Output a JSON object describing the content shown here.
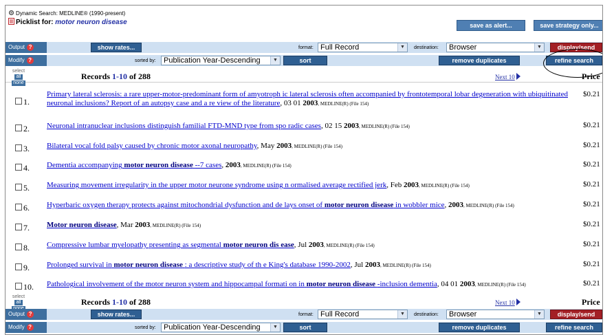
{
  "header": {
    "search_label": "Dynamic Search: MEDLINE® (1990-present)",
    "picklist_prefix": "Picklist for:",
    "picklist_query": "motor neuron disease",
    "save_alert": "save as alert...",
    "save_strategy": "save strategy only..."
  },
  "toolbar": {
    "output_label": "Output",
    "modify_label": "Modify",
    "help_glyph": "?",
    "show_rates": "show rates...",
    "format_label": "format:",
    "format_value": "Full Record",
    "destination_label": "destination:",
    "destination_value": "Browser",
    "display_send": "display/send",
    "sorted_by_label": "sorted by:",
    "sort_value": "Publication Year-Descending",
    "sort_button": "sort",
    "remove_duplicates": "remove duplicates",
    "refine_search": "refine search"
  },
  "records_bar": {
    "select_label": "select",
    "all": "all",
    "none": "none",
    "records_label": "Records",
    "range": "1-10",
    "of_label": "of",
    "total": "288",
    "next": "Next 10",
    "price_header": "Price"
  },
  "records": [
    {
      "num": "1.",
      "title": "Primary lateral sclerosis: a rare upper-motor-predominant form of amyotroph ic lateral sclerosis often accompanied by frontotemporal lobar degeneration with ubiquitinated neuronal inclusions? Report of an autopsy case and a re view of the literature",
      "hl": "",
      "tail": "",
      "date": ", 03 01",
      "year": "2003",
      "source": ", MEDLINE(R) (File 154)",
      "price": "$0.21"
    },
    {
      "num": "2.",
      "title": "Neuronal intranuclear inclusions distinguish familial FTD-MND type from spo radic cases",
      "hl": "",
      "tail": "",
      "date": ", 02 15",
      "year": "2003",
      "source": ", MEDLINE(R) (File 154)",
      "price": "$0.21"
    },
    {
      "num": "3.",
      "title": "Bilateral vocal fold palsy caused by chronic motor axonal neuropathy",
      "hl": "",
      "tail": "",
      "date": ", May",
      "year": "2003",
      "source": ", MEDLINE(R) (File 154)",
      "price": "$0.21"
    },
    {
      "num": "4.",
      "title": "Dementia accompanying",
      "hl": "motor neuron disease",
      "tail": "--7 cases",
      "date": ",",
      "year": "2003",
      "source": ", MEDLINE(R) (File 154)",
      "price": "$0.21"
    },
    {
      "num": "5.",
      "title": "Measuring movement irregularity in the upper motor neurone syndrome using n ormalised average rectified jerk",
      "hl": "",
      "tail": "",
      "date": ", Feb",
      "year": "2003",
      "source": ", MEDLINE(R) (File 154)",
      "price": "$0.21"
    },
    {
      "num": "6.",
      "title": "Hyperbaric oxygen therapy protects against mitochondrial dysfunction and de lays onset of",
      "hl": "motor neuron disease",
      "tail": "in wobbler mice",
      "date": ",",
      "year": "2003",
      "source": ", MEDLINE(R) (File 154)",
      "price": "$0.21"
    },
    {
      "num": "7.",
      "title": "",
      "hl": "Motor neuron disease",
      "tail": "",
      "date": ", Mar",
      "year": "2003",
      "source": ", MEDLINE(R) (File 154)",
      "price": "$0.21"
    },
    {
      "num": "8.",
      "title": "Compressive lumbar myelopathy presenting as segmental",
      "hl": "motor neuron dis ease",
      "tail": "",
      "date": ", Jul",
      "year": "2003",
      "source": ", MEDLINE(R) (File 154)",
      "price": "$0.21"
    },
    {
      "num": "9.",
      "title": "Prolonged survival in",
      "hl": "motor neuron disease",
      "tail": ": a descriptive study of th e King's database 1990-2002",
      "date": ", Jul",
      "year": "2003",
      "source": ", MEDLINE(R) (File 154)",
      "price": "$0.21"
    },
    {
      "num": "10.",
      "title": "Pathological involvement of the motor neuron system and hippocampal formati on in",
      "hl": "motor neuron disease",
      "tail": "-inclusion dementia",
      "date": ", 04 01",
      "year": "2003",
      "source": ", MEDLINE(R) (File 154)",
      "price": "$0.21"
    }
  ],
  "colors": {
    "bar_bg": "#cfe0f2",
    "label_bg": "#3e6f9f",
    "button_blue": "#2f5f92",
    "button_red": "#a31f25",
    "link": "#0000cc"
  }
}
